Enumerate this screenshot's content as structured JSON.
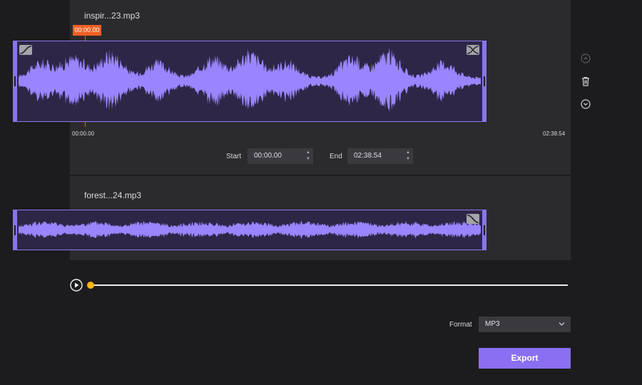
{
  "tracks": [
    {
      "title": "inspir...23.mp3",
      "playhead_time": "00:00.00",
      "start_time_label": "00:00.00",
      "end_time_label": "02:38.54",
      "start_label": "Start",
      "end_label": "End",
      "start_value": "00:00.00",
      "end_value": "02:38.54",
      "fade_in_icon": "fade-in-icon",
      "fade_out_icon": "fade-out-icon"
    },
    {
      "title": "forest...24.mp3",
      "fade_out_icon": "fade-out-icon"
    }
  ],
  "side_icons": [
    "chevron-up-circle-icon",
    "trash-icon",
    "chevron-down-circle-icon"
  ],
  "player": {
    "progress": 0,
    "play_icon": "play-icon"
  },
  "format": {
    "label": "Format",
    "value": "MP3"
  },
  "export": {
    "label": "Export"
  },
  "colors": {
    "waveform": "#9b85ff",
    "waveform_bg": "#2e2647",
    "accent": "#8b6ff3",
    "playhead": "#f06022",
    "progress_knob": "#f5b715"
  }
}
